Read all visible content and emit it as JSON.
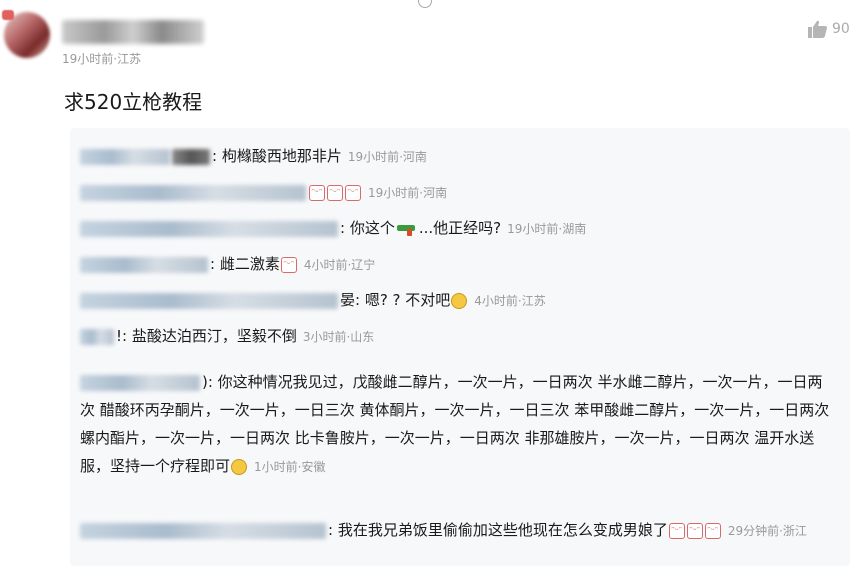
{
  "comment": {
    "meta": "19小时前·江苏",
    "text": "求520立枪教程",
    "like_count": "90"
  },
  "replies": [
    {
      "text": ": 枸橼酸西地那非片",
      "meta": "19小时前·河南"
    },
    {
      "text": "",
      "meta": "19小时前·河南",
      "emojis": [
        "sticker",
        "sticker",
        "sticker"
      ]
    },
    {
      "text_before": ": 你这个",
      "text_after": "...他正经吗?",
      "meta": "19小时前·湖南"
    },
    {
      "text": ": 雌二激素",
      "meta": "4小时前·辽宁"
    },
    {
      "text_before": "晏: 嗯? ? 不对吧",
      "meta": "4小时前·江苏"
    },
    {
      "text": "!: 盐酸达泊西汀，坚毅不倒",
      "meta": "3小时前·山东"
    },
    {
      "text": "): 你这种情况我见过，戊酸雌二醇片，一次一片，一日两次 半水雌二醇片，一次一片，一日两次 醋酸环丙孕酮片，一次一片，一日三次 黄体酮片，一次一片，一日三次 苯甲酸雌二醇片，一次一片，一日两次 螺内酯片，一次一片，一日两次 比卡鲁胺片，一次一片，一日两次 非那雄胺片，一次一片，一日两次 温开水送服，坚持一个疗程即可",
      "meta": "1小时前·安徽"
    },
    {
      "text": ": 我在我兄弟饭里偷偷加这些他现在怎么变成男娘了",
      "meta": "29分钟前·浙江"
    }
  ],
  "icons": {
    "like": "thumbs-up-icon"
  },
  "colors": {
    "meta_gray": "#999999",
    "reply_bg": "#f7f8fa"
  }
}
